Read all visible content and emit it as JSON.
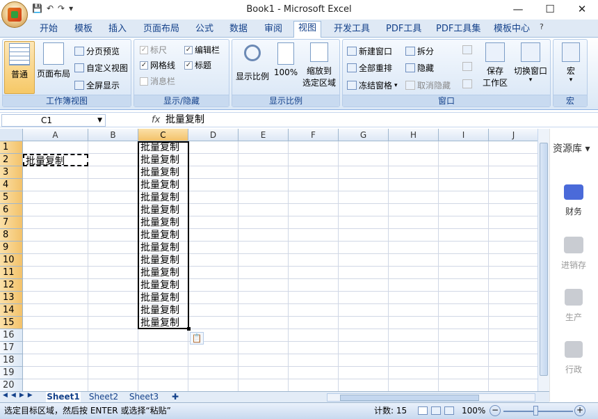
{
  "window": {
    "title": "Book1 - Microsoft Excel",
    "minimize": "—",
    "maximize": "☐",
    "close": "✕"
  },
  "qat": {
    "save": "💾",
    "undo": "↶",
    "redo": "↷",
    "more": "▾"
  },
  "tabs": [
    {
      "label": "开始"
    },
    {
      "label": "模板"
    },
    {
      "label": "插入"
    },
    {
      "label": "页面布局"
    },
    {
      "label": "公式"
    },
    {
      "label": "数据"
    },
    {
      "label": "审阅"
    },
    {
      "label": "视图"
    },
    {
      "label": "开发工具"
    },
    {
      "label": "PDF工具"
    },
    {
      "label": "PDF工具集"
    },
    {
      "label": "模板中心"
    }
  ],
  "tab_help": "?",
  "ribbon": {
    "workbook_views": {
      "label": "工作簿视图",
      "normal": "普通",
      "page_layout": "页面布局",
      "page_break": "分页预览",
      "custom": "自定义视图",
      "fullscreen": "全屏显示"
    },
    "show_hide": {
      "label": "显示/隐藏",
      "ruler": "标尺",
      "gridlines": "网格线",
      "message_bar": "消息栏",
      "formula_bar": "编辑栏",
      "headings": "标题"
    },
    "zoom": {
      "label": "显示比例",
      "zoom": "显示比例",
      "zoom100": "100%",
      "zoom_sel_1": "缩放到",
      "zoom_sel_2": "选定区域"
    },
    "window": {
      "label": "窗口",
      "new_window": "新建窗口",
      "arrange_all": "全部重排",
      "freeze": "冻结窗格",
      "split": "拆分",
      "hide": "隐藏",
      "unhide": "取消隐藏",
      "save_ws_1": "保存",
      "save_ws_2": "工作区",
      "switch": "切换窗口"
    },
    "macro": {
      "label": "宏",
      "btn": "宏"
    }
  },
  "formula_bar": {
    "name_box": "C1",
    "fx": "fx",
    "content": "批量复制"
  },
  "columns": [
    "A",
    "B",
    "C",
    "D",
    "E",
    "F",
    "G",
    "H",
    "I",
    "J"
  ],
  "rows": [
    "1",
    "2",
    "3",
    "4",
    "5",
    "6",
    "7",
    "8",
    "9",
    "10",
    "11",
    "12",
    "13",
    "14",
    "15",
    "16",
    "17",
    "18",
    "19",
    "20"
  ],
  "cells": {
    "A2": "批量复制",
    "C": [
      "批量复制",
      "批量复制",
      "批量复制",
      "批量复制",
      "批量复制",
      "批量复制",
      "批量复制",
      "批量复制",
      "批量复制",
      "批量复制",
      "批量复制",
      "批量复制",
      "批量复制",
      "批量复制",
      "批量复制"
    ]
  },
  "sheets": [
    "Sheet1",
    "Sheet2",
    "Sheet3"
  ],
  "side_panel": {
    "title": "资源库",
    "items": [
      {
        "label": "财务"
      },
      {
        "label": "进销存"
      },
      {
        "label": "生产"
      },
      {
        "label": "行政"
      }
    ]
  },
  "status": {
    "message": "选定目标区域，然后按 ENTER 或选择“粘贴”",
    "count": "计数: 15",
    "zoom": "100%"
  },
  "colors": {
    "accent": "#f3c26a",
    "ribbon": "#dbe8f6",
    "tab_text": "#15428b"
  }
}
